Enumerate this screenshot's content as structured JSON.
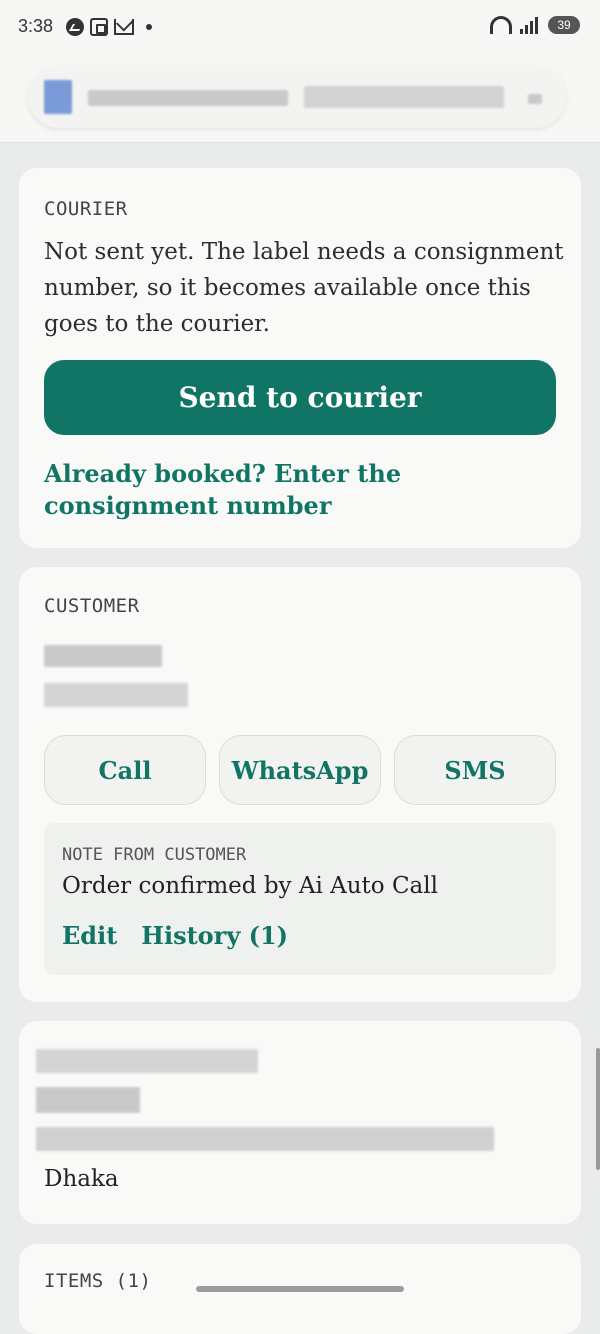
{
  "status_bar": {
    "time": "3:38",
    "battery": "39",
    "icons_left": [
      "messenger-icon",
      "scan-icon",
      "gmail-icon",
      "dot-icon"
    ],
    "icons_right": [
      "wifi-icon",
      "signal-icon",
      "battery-icon"
    ]
  },
  "courier": {
    "section_label": "COURIER",
    "message": "Not sent yet. The label needs a consignment number, so it becomes available once this goes to the courier.",
    "send_button_label": "Send to courier",
    "booked_link": "Already booked? Enter the consignment number"
  },
  "customer": {
    "section_label": "CUSTOMER",
    "actions": {
      "call": "Call",
      "whatsapp": "WhatsApp",
      "sms": "SMS"
    },
    "note": {
      "label": "NOTE FROM CUSTOMER",
      "text": "Order confirmed by Ai Auto Call",
      "edit": "Edit",
      "history": "History (1)"
    }
  },
  "address": {
    "city": "Dhaka"
  },
  "items": {
    "section_label": "ITEMS (1)"
  },
  "colors": {
    "accent": "#117566",
    "card": "#f9f9f7",
    "background": "#e9ecea"
  }
}
